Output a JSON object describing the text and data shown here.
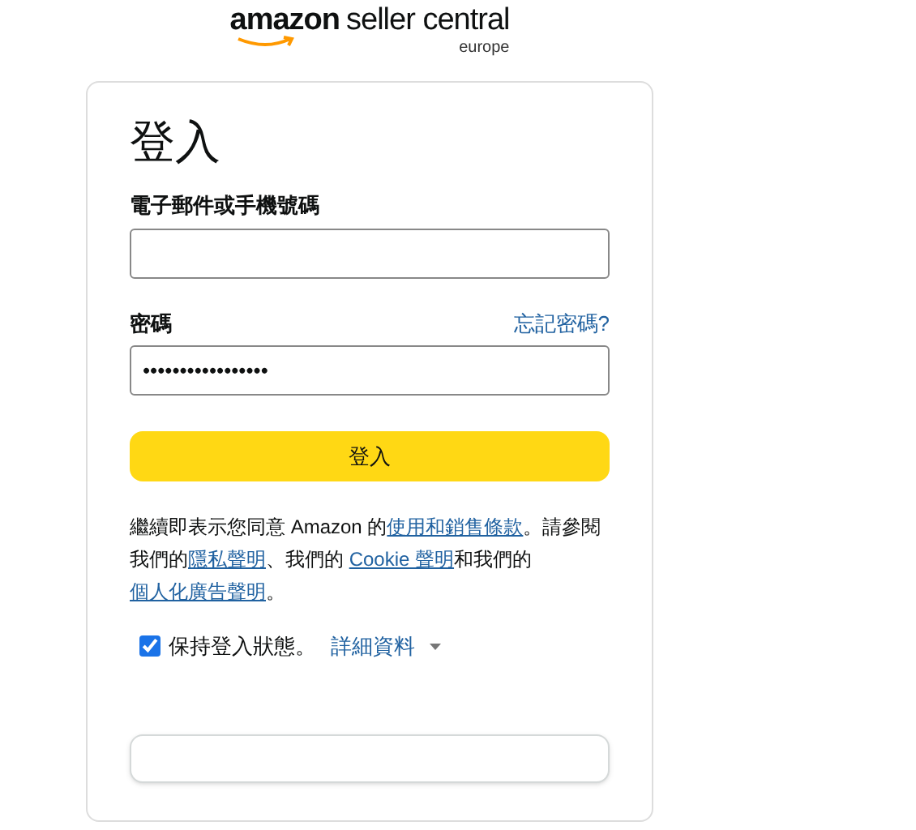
{
  "logo": {
    "brand": "amazon",
    "product": "seller central",
    "region": "europe"
  },
  "form": {
    "title": "登入",
    "email": {
      "label": "電子郵件或手機號碼"
    },
    "password": {
      "label": "密碼",
      "forgot_link": "忘記密碼?",
      "value": "•••••••••••••••••"
    },
    "submit": "登入",
    "legal": [
      {
        "text": "繼續即表示您同意 Amazon 的",
        "link": false
      },
      {
        "text": "使用和銷售條款",
        "link": true
      },
      {
        "text": "。請參閱我們的",
        "link": false
      },
      {
        "text": "隱私聲明",
        "link": true
      },
      {
        "text": "、我們的 ",
        "link": false
      },
      {
        "text": "Cookie 聲明",
        "link": true
      },
      {
        "text": "和我們的",
        "link": false
      },
      {
        "text": "個人化廣告聲明",
        "link": true
      },
      {
        "text": "。",
        "link": false
      }
    ],
    "remember": {
      "label": "保持登入狀態。",
      "checked": true,
      "details_link": "詳細資料"
    }
  }
}
